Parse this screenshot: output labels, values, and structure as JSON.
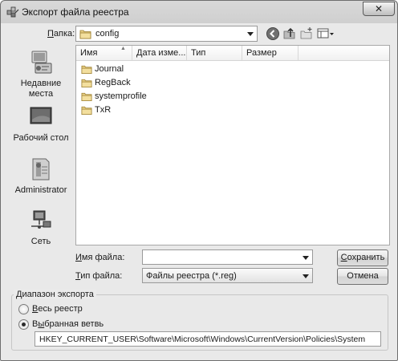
{
  "window": {
    "title": "Экспорт файла реестра",
    "close_glyph": "✕"
  },
  "folder_bar": {
    "label_underlined": "П",
    "label_rest": "апка:",
    "current_folder": "config"
  },
  "toolbar_icons": [
    "back-icon",
    "up-folder-icon",
    "new-folder-icon",
    "views-menu-icon"
  ],
  "places": [
    {
      "id": "recent",
      "line1": "Недавние",
      "line2": "места",
      "icon": "recent-places-icon"
    },
    {
      "id": "desktop",
      "line1": "Рабочий стол",
      "line2": "",
      "icon": "desktop-icon"
    },
    {
      "id": "user",
      "line1": "Administrator",
      "line2": "",
      "icon": "user-folder-icon"
    },
    {
      "id": "network",
      "line1": "Сеть",
      "line2": "",
      "icon": "network-icon"
    }
  ],
  "columns": [
    "Имя",
    "Дата изме...",
    "Тип",
    "Размер"
  ],
  "files": [
    {
      "name": "Journal"
    },
    {
      "name": "RegBack"
    },
    {
      "name": "systemprofile"
    },
    {
      "name": "TxR"
    }
  ],
  "filename": {
    "label_underlined": "И",
    "label_rest": "мя файла:",
    "value": ""
  },
  "filetype": {
    "label_underlined": "Т",
    "label_rest": "ип файла:",
    "value": "Файлы реестра (*.reg)"
  },
  "buttons": {
    "save_underlined": "С",
    "save_rest": "охранить",
    "cancel": "Отмена"
  },
  "export_range": {
    "title": "Диапазон экспорта",
    "all_underlined": "В",
    "all_rest": "есь реестр",
    "branch_label_start": "В",
    "branch_underlined": "ы",
    "branch_rest": "бранная ветвь",
    "selected": "branch",
    "branch_path": "HKEY_CURRENT_USER\\Software\\Microsoft\\Windows\\CurrentVersion\\Policies\\System"
  },
  "colors": {
    "folder": "#d9b860",
    "title_bar": "#d3d3d3",
    "dialog_bg": "#ebebeb"
  }
}
